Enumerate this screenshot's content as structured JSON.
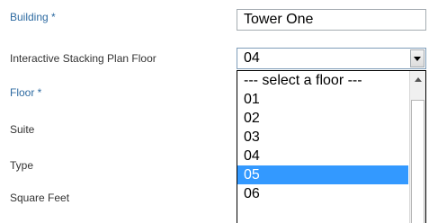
{
  "form": {
    "building_label": "Building *",
    "building_value": "Tower One",
    "isp_floor_label": "Interactive Stacking Plan Floor",
    "isp_floor_value": "04",
    "floor_label": "Floor *",
    "suite_label": "Suite",
    "type_label": "Type",
    "square_feet_label": "Square Feet"
  },
  "dropdown": {
    "options": [
      "--- select a floor ---",
      "01",
      "02",
      "03",
      "04",
      "05",
      "06"
    ],
    "highlighted": "05"
  },
  "colors": {
    "required_label": "#2d6aa1",
    "highlight": "#3399ff"
  }
}
